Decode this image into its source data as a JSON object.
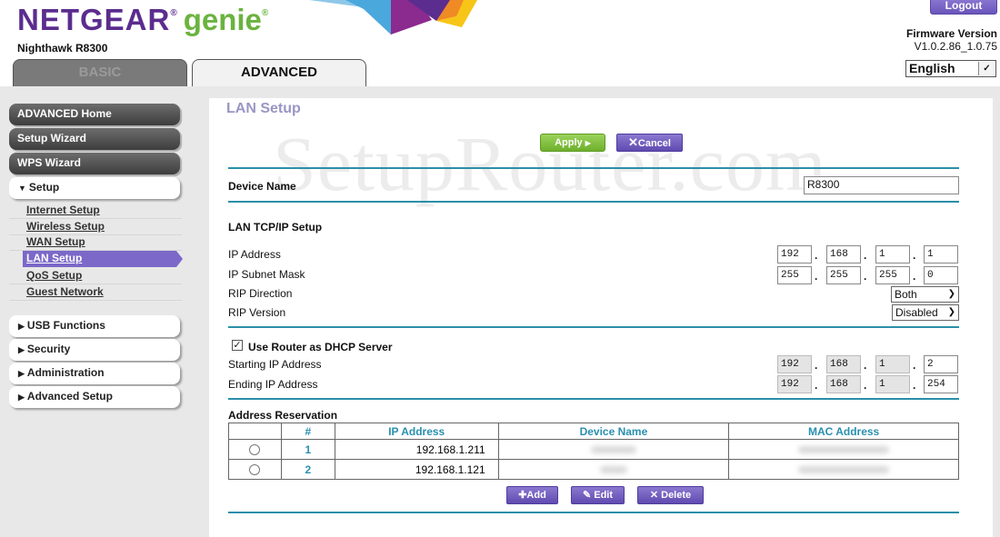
{
  "header": {
    "brand": "NETGEAR",
    "product": "genie",
    "model": "Nighthawk R8300",
    "logout_label": "Logout",
    "firmware_label": "Firmware Version",
    "firmware_value": "V1.0.2.86_1.0.75",
    "language": "English",
    "tabs": [
      {
        "label": "BASIC",
        "active": false
      },
      {
        "label": "ADVANCED",
        "active": true
      }
    ]
  },
  "sidebar": {
    "top_items": [
      "ADVANCED Home",
      "Setup Wizard",
      "WPS Wizard"
    ],
    "setup_section": {
      "label": "Setup",
      "expanded": true,
      "items": [
        "Internet Setup",
        "Wireless Setup",
        "WAN Setup",
        "LAN Setup",
        "QoS Setup",
        "Guest Network"
      ],
      "active": "LAN Setup"
    },
    "collapsed_sections": [
      "USB Functions",
      "Security",
      "Administration",
      "Advanced Setup"
    ]
  },
  "main": {
    "title": "LAN Setup",
    "watermark": "SetupRouter.com",
    "apply_label": "Apply",
    "cancel_label": "Cancel",
    "device_name_label": "Device Name",
    "device_name_value": "R8300",
    "lan_tcpip_heading": "LAN TCP/IP Setup",
    "ip_address_label": "IP Address",
    "ip_address": [
      "192",
      "168",
      "1",
      "1"
    ],
    "subnet_label": "IP Subnet Mask",
    "subnet": [
      "255",
      "255",
      "255",
      "0"
    ],
    "rip_direction_label": "RIP Direction",
    "rip_direction": "Both",
    "rip_version_label": "RIP Version",
    "rip_version": "Disabled",
    "dhcp_checkbox_label": "Use Router as DHCP Server",
    "dhcp_enabled": true,
    "start_ip_label": "Starting IP Address",
    "start_ip": [
      "192",
      "168",
      "1",
      "2"
    ],
    "end_ip_label": "Ending IP Address",
    "end_ip": [
      "192",
      "168",
      "1",
      "254"
    ],
    "reservation_heading": "Address Reservation",
    "reservation_columns": [
      "",
      "#",
      "IP Address",
      "Device Name",
      "MAC Address"
    ],
    "reservations": [
      {
        "num": "1",
        "ip": "192.168.1.211",
        "device": "",
        "mac": ""
      },
      {
        "num": "2",
        "ip": "192.168.1.121",
        "device": "",
        "mac": ""
      }
    ],
    "add_label": "Add",
    "edit_label": "Edit",
    "delete_label": "Delete"
  }
}
